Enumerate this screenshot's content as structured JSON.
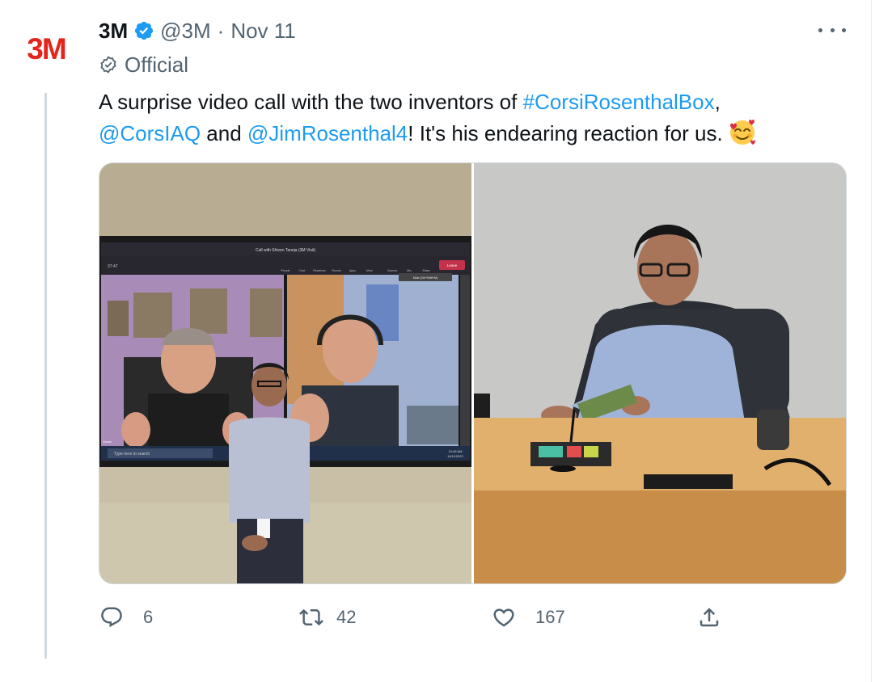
{
  "author": {
    "name": "3M",
    "handle": "@3M",
    "separator": "·",
    "date": "Nov 11",
    "logo_text": "3M",
    "label": "Official"
  },
  "tweet": {
    "part1": "A surprise video call with the two inventors of ",
    "hashtag": "#CorsiRosenthalBox",
    "part2": ",",
    "mention1": "@CorsIAQ",
    "part3": " and ",
    "mention2": "@JimRosenthal4",
    "part4": "! It's his endearing reaction for us.",
    "emoji": "smiling-face-with-hearts"
  },
  "media_left": {
    "call_title": "Call with Shiven Taneja (3M Visit)",
    "call_timer": "37:47",
    "toolbar": [
      "People",
      "Chat",
      "Reactions",
      "Rooms",
      "Apps",
      "More",
      "Camera",
      "Mic",
      "Share"
    ],
    "leave_label": "Leave",
    "mute_tooltip": "Mute (Ctrl+Shift+M)",
    "tile1_label": "Guest",
    "tile2_label": "Guest",
    "search_text": "Type here to search",
    "clock_time": "10:45 AM",
    "clock_date": "11/11/2022"
  },
  "actions": {
    "reply_count": "6",
    "retweet_count": "42",
    "like_count": "167"
  },
  "colors": {
    "link": "#1d9bf0",
    "verified": "#1d9bf0",
    "brand_red": "#e3261b",
    "secondary_text": "#536471"
  }
}
